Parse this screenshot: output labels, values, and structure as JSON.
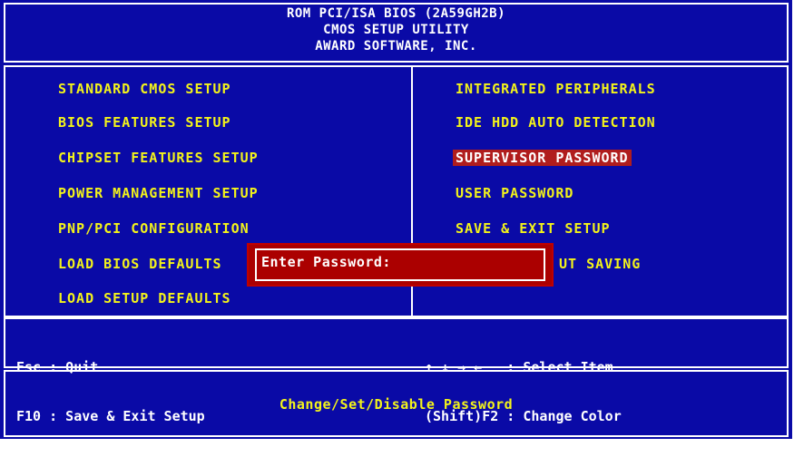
{
  "header": {
    "line1": "ROM PCI/ISA BIOS (2A59GH2B)",
    "line2": "CMOS SETUP UTILITY",
    "line3": "AWARD SOFTWARE, INC."
  },
  "menu_left": [
    {
      "label": "STANDARD CMOS SETUP"
    },
    {
      "label": "BIOS FEATURES SETUP"
    },
    {
      "label": "CHIPSET FEATURES SETUP"
    },
    {
      "label": "POWER MANAGEMENT SETUP"
    },
    {
      "label": "PNP/PCI CONFIGURATION"
    },
    {
      "label": "LOAD BIOS DEFAULTS"
    },
    {
      "label": "LOAD SETUP DEFAULTS"
    }
  ],
  "menu_right": [
    {
      "label": "INTEGRATED PERIPHERALS"
    },
    {
      "label": "IDE HDD AUTO DETECTION"
    },
    {
      "label": "SUPERVISOR PASSWORD",
      "selected": true
    },
    {
      "label": "USER PASSWORD"
    },
    {
      "label": "SAVE & EXIT SETUP"
    },
    {
      "label": "UT SAVING"
    }
  ],
  "help": {
    "left_line1": "Esc : Quit",
    "left_line2": "F10 : Save & Exit Setup",
    "right_line1": "↑ ↓ → ←   : Select Item",
    "right_line2": "(Shift)F2 : Change Color"
  },
  "status_text": "Change/Set/Disable Password",
  "password_dialog": {
    "label": "Enter Password:",
    "value": ""
  },
  "colors": {
    "background": "#0a0aa6",
    "menu_text": "#f3f31a",
    "highlight": "#b01d1d",
    "dialog": "#ab0000"
  }
}
